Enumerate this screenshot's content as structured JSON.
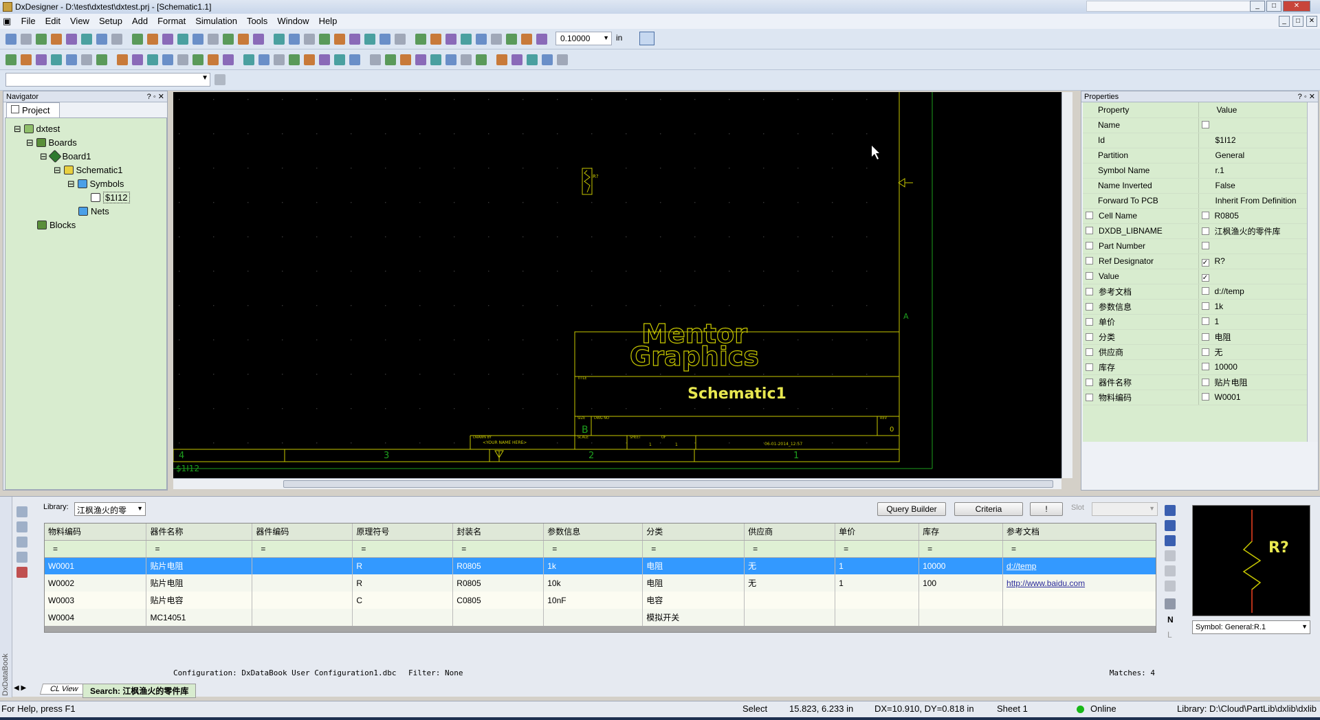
{
  "window": {
    "title": "DxDesigner - D:\\test\\dxtest\\dxtest.prj - [Schematic1.1]"
  },
  "menu": [
    "File",
    "Edit",
    "View",
    "Setup",
    "Add",
    "Format",
    "Simulation",
    "Tools",
    "Window",
    "Help"
  ],
  "toolbar": {
    "grid_value": "0.10000",
    "unit": "in",
    "search_value": ""
  },
  "navigator": {
    "title": "Navigator",
    "tab": "Project",
    "tree": [
      {
        "label": "dxtest",
        "level": 0
      },
      {
        "label": "Boards",
        "level": 1
      },
      {
        "label": "Board1",
        "level": 2
      },
      {
        "label": "Schematic1",
        "level": 3
      },
      {
        "label": "Symbols",
        "level": 4
      },
      {
        "label": "$1I12",
        "level": 5
      },
      {
        "label": "Nets",
        "level": 4
      },
      {
        "label": "Blocks",
        "level": 1
      }
    ]
  },
  "canvas": {
    "logo_line1": "Mentor",
    "logo_line2": "Graphics",
    "sheet_title": "Schematic1",
    "ref": "R?",
    "col_labels": [
      "4",
      "3",
      "2",
      "1"
    ],
    "row_label": "A",
    "bottom_label": "$1I12",
    "size_letter": "B",
    "rev": "0",
    "drawn_by": "<YOUR NAME HERE>",
    "date": "06-01-2014_12:57",
    "tb_labels": {
      "drawn": "DRAWN BY",
      "title": "TITLE",
      "size": "SIZE",
      "dwg": "DWG NO",
      "rev": "REV",
      "scale": "SCALE",
      "sheet": "SHEET",
      "of": "OF",
      "sheet_num": "1",
      "of_num": "1"
    }
  },
  "properties": {
    "title": "Properties",
    "header": [
      "Property",
      "Value"
    ],
    "rows": [
      {
        "name": "Name",
        "value": "",
        "cb_name": null,
        "cb_value": false
      },
      {
        "name": "Id",
        "value": "$1I12",
        "cb_name": null,
        "cb_value": null
      },
      {
        "name": "Partition",
        "value": "General",
        "cb_name": null,
        "cb_value": null
      },
      {
        "name": "Symbol Name",
        "value": "r.1",
        "cb_name": null,
        "cb_value": null
      },
      {
        "name": "Name Inverted",
        "value": "False",
        "cb_name": null,
        "cb_value": null
      },
      {
        "name": "Forward To PCB",
        "value": "Inherit From Definition",
        "cb_name": null,
        "cb_value": null
      },
      {
        "name": "Cell Name",
        "value": "R0805",
        "cb_name": false,
        "cb_value": false
      },
      {
        "name": "DXDB_LIBNAME",
        "value": "江枫渔火的零件库",
        "cb_name": false,
        "cb_value": false
      },
      {
        "name": "Part Number",
        "value": "",
        "cb_name": false,
        "cb_value": false
      },
      {
        "name": "Ref Designator",
        "value": "R?",
        "cb_name": false,
        "cb_value": true
      },
      {
        "name": "Value",
        "value": "",
        "cb_name": false,
        "cb_value": true
      },
      {
        "name": "参考文档",
        "value": "d://temp",
        "cb_name": false,
        "cb_value": false
      },
      {
        "name": "参数信息",
        "value": "1k",
        "cb_name": false,
        "cb_value": false
      },
      {
        "name": "单价",
        "value": "1",
        "cb_name": false,
        "cb_value": false
      },
      {
        "name": "分类",
        "value": "电阻",
        "cb_name": false,
        "cb_value": false
      },
      {
        "name": "供应商",
        "value": "无",
        "cb_name": false,
        "cb_value": false
      },
      {
        "name": "库存",
        "value": "10000",
        "cb_name": false,
        "cb_value": false
      },
      {
        "name": "器件名称",
        "value": "贴片电阻",
        "cb_name": false,
        "cb_value": false
      },
      {
        "name": "物料编码",
        "value": "W0001",
        "cb_name": false,
        "cb_value": false
      }
    ]
  },
  "databook": {
    "side_label": "DxDataBook",
    "library_label": "Library:",
    "library_value": "江枫渔火的零",
    "query_builder": "Query Builder",
    "criteria": "Criteria",
    "bang": "!",
    "slot_label": "Slot",
    "columns": [
      "物料编码",
      "器件名称",
      "器件编码",
      "原理符号",
      "封装名",
      "参数信息",
      "分类",
      "供应商",
      "单价",
      "库存",
      "参考文档"
    ],
    "filter": "=",
    "rows": [
      [
        "W0001",
        "贴片电阻",
        "",
        "R",
        "R0805",
        "1k",
        "电阻",
        "无",
        "1",
        "10000",
        "d://temp"
      ],
      [
        "W0002",
        "贴片电阻",
        "",
        "R",
        "R0805",
        "10k",
        "电阻",
        "无",
        "1",
        "100",
        "http://www.baidu.com"
      ],
      [
        "W0003",
        "贴片电容",
        "",
        "C",
        "C0805",
        "10nF",
        "电容",
        "",
        "",
        "",
        ""
      ],
      [
        "W0004",
        "MC14051",
        "",
        "",
        "",
        "",
        "模拟开关",
        "",
        "",
        "",
        ""
      ]
    ],
    "config": "Configuration: DxDataBook User Configuration1.dbc",
    "filter_text": "Filter: None",
    "matches": "Matches: 4",
    "tabs": [
      "CL View",
      "Search: 江枫渔火的零件库"
    ],
    "preview_ref": "R?",
    "symbol_select": "Symbol: General:R.1",
    "n_label": "N",
    "l_label": "L"
  },
  "status": {
    "help": "For Help, press F1",
    "mode": "Select",
    "coords": "15.823, 6.233 in",
    "delta": "DX=10.910, DY=0.818 in",
    "sheet": "Sheet 1",
    "online": "Online",
    "library": "Library: D:\\Cloud\\PartLib\\dxlib\\dxlib"
  }
}
